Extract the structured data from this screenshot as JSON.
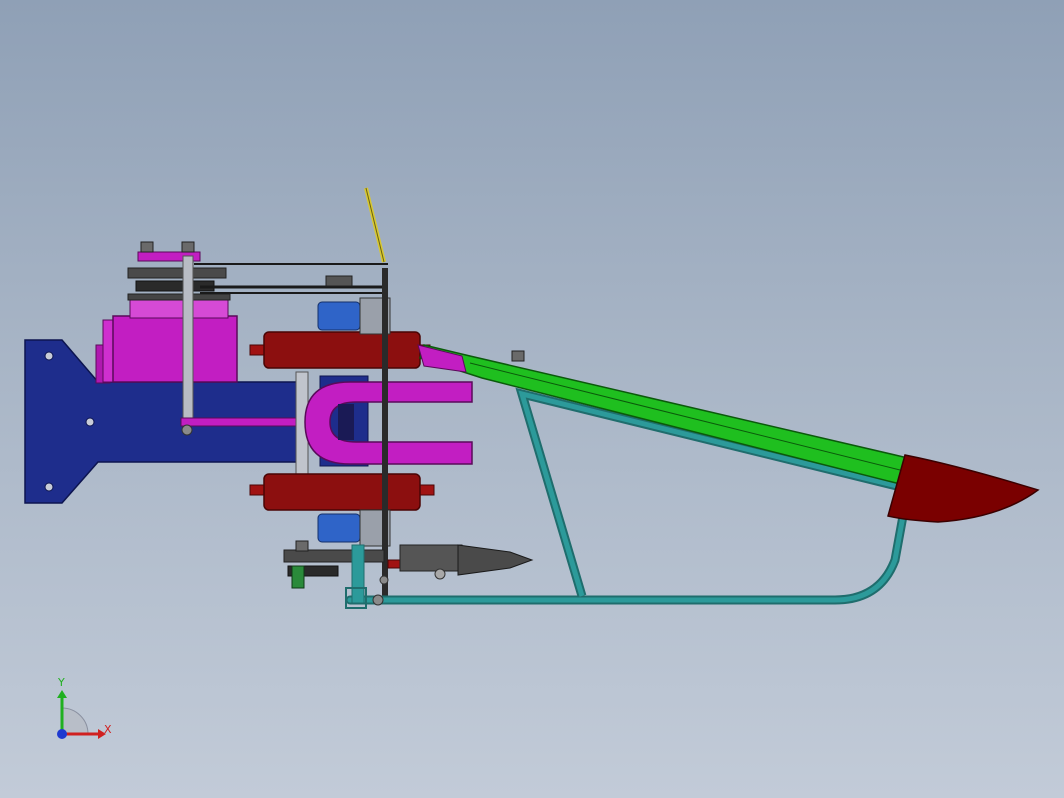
{
  "viewport": {
    "colors": {
      "background_top": "#8fa0b6",
      "background_bottom": "#c2cbd8",
      "base_plate": "#1e2d8c",
      "gearbox": "#c21ec2",
      "clamp_block": "#8c0f0f",
      "arm": "#1fbf1f",
      "frame": "#2c9a9a",
      "bearing": "#2f64c8",
      "hardware": "#6a6a6a"
    }
  },
  "triad": {
    "x_label": "X",
    "y_label": "Y",
    "x_color": "#d02020",
    "y_color": "#20b020",
    "z_color": "#1f3ad0"
  }
}
